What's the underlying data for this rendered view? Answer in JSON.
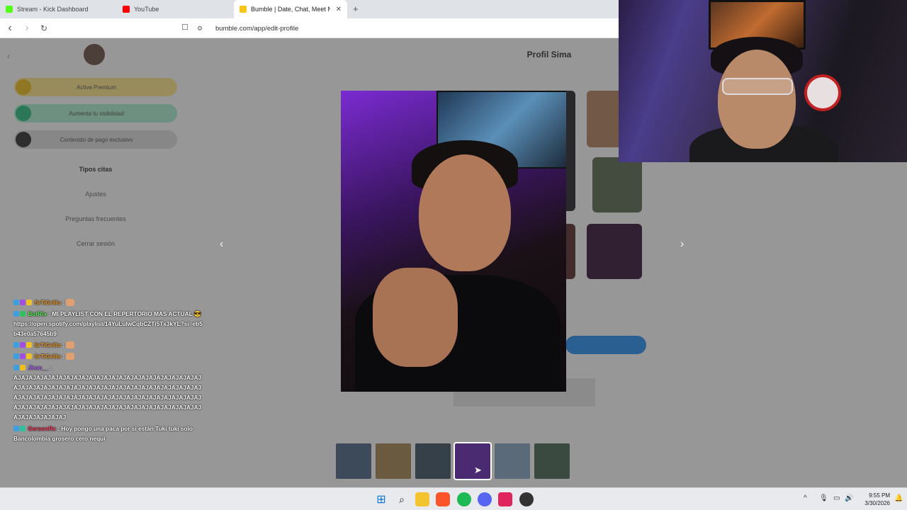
{
  "browser": {
    "tabs": [
      {
        "title": "Stream - Kick Dashboard",
        "color": "#53fc18"
      },
      {
        "title": "YouTube",
        "color": "#ff0000"
      },
      {
        "title": "Bumble | Date, Chat, Meet New F",
        "color": "#f5c518"
      }
    ],
    "new_tab_label": "+",
    "close_label": "✕",
    "url": "bumble.com/app/edit-profile",
    "back": "‹",
    "forward": "›",
    "reload": "↻"
  },
  "page": {
    "header_title": "Profil Sima",
    "sidebar": {
      "pills": [
        {
          "label": "Activa Premium",
          "color": "#f5dd88",
          "dot": "#e6b820"
        },
        {
          "label": "Aumenta tu visibilidad",
          "color": "#a8e6c9",
          "dot": "#2fb880"
        },
        {
          "label": "Contenido de pago exclusivo",
          "color": "#d5d5d5",
          "dot": "#333333"
        }
      ],
      "links": [
        "Tipos citas",
        "Ajustes",
        "Preguntas frecuentes",
        "Cerrar sesión"
      ]
    },
    "prev_arrow": "‹",
    "next_arrow": "›"
  },
  "chat": [
    {
      "user": "SrTiGrillo",
      "color_class": "name-orange",
      "message": ""
    },
    {
      "user": "BotRix",
      "color_class": "name-green",
      "message": "MI PLAYLIST CON EL REPERTORIO MAS ACTUAL 😎 https://open.spotify.com/playlist/14YuLuIwCqbCZTi5Tx3kYL?si=eb5b43e0a57645b9"
    },
    {
      "user": "SrTiGrillo",
      "color_class": "name-orange",
      "message": ""
    },
    {
      "user": "SrTiGrillo",
      "color_class": "name-orange",
      "message": ""
    },
    {
      "user": "Jhon__",
      "color_class": "name-purple",
      "message": "AJAJAJAJAJAJAJAJAJAJAJAJAJAJAJAJAJAJAJAJAJAJAJAJAJAJAJAJAJAJAJAJAJAJAJAJAJAJAJAJAJAJAJAJAJAJAJAJAJAJAJAJAJAJAJAJAJAJAJAJAJAJAJAJAJAJAJAJAJAJAJAJAJAJAJAJAJAJAJAJAJAJAJAJAJAJAJAJAJAJAJAJAJAJAJAJAJAJAJAJAJAJAJAJAJAJAJ"
    },
    {
      "user": "GersonRx",
      "color_class": "name-red",
      "message": "Hoy pongo una paca por si están Tuki tuki solo Bancolombia grosero cero nequi"
    }
  ],
  "taskbar": {
    "tray_chevron": "^",
    "time": "9:55 PM",
    "date": "3/30/2026"
  }
}
